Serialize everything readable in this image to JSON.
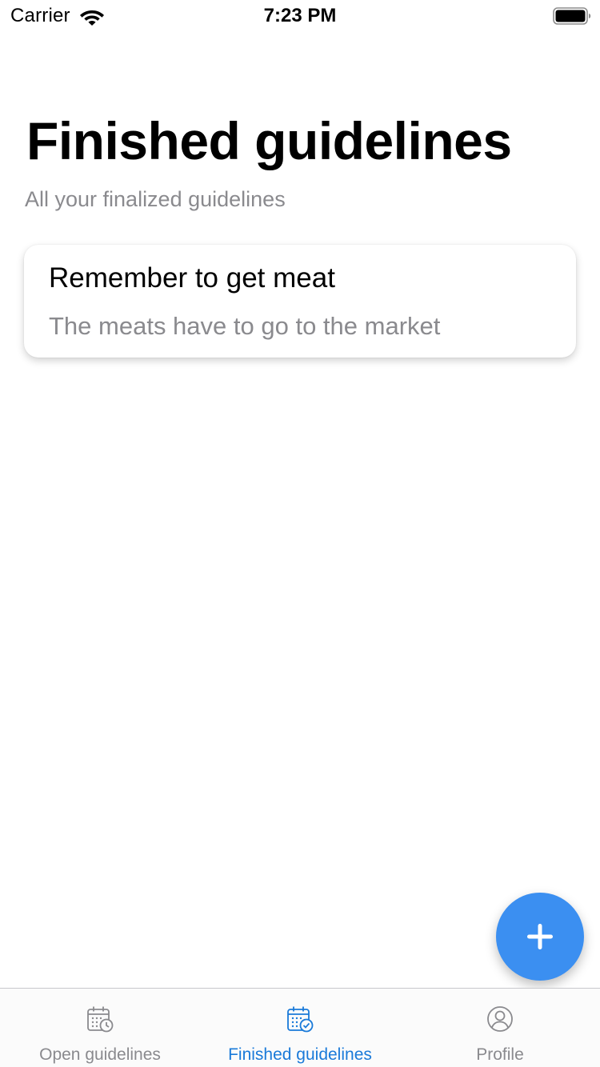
{
  "status_bar": {
    "carrier": "Carrier",
    "time": "7:23 PM"
  },
  "header": {
    "title": "Finished guidelines",
    "subtitle": "All your finalized guidelines"
  },
  "guidelines": [
    {
      "title": "Remember to get meat",
      "description": "The meats have to go to the market"
    }
  ],
  "fab": {
    "icon": "plus-icon",
    "color": "#3b8ff1"
  },
  "tab_bar": {
    "active_color": "#1a7ad9",
    "inactive_color": "#8a8a8e",
    "tabs": [
      {
        "label": "Open guidelines",
        "icon": "calendar-clock-icon",
        "active": false
      },
      {
        "label": "Finished guidelines",
        "icon": "calendar-check-icon",
        "active": true
      },
      {
        "label": "Profile",
        "icon": "user-circle-icon",
        "active": false
      }
    ]
  }
}
